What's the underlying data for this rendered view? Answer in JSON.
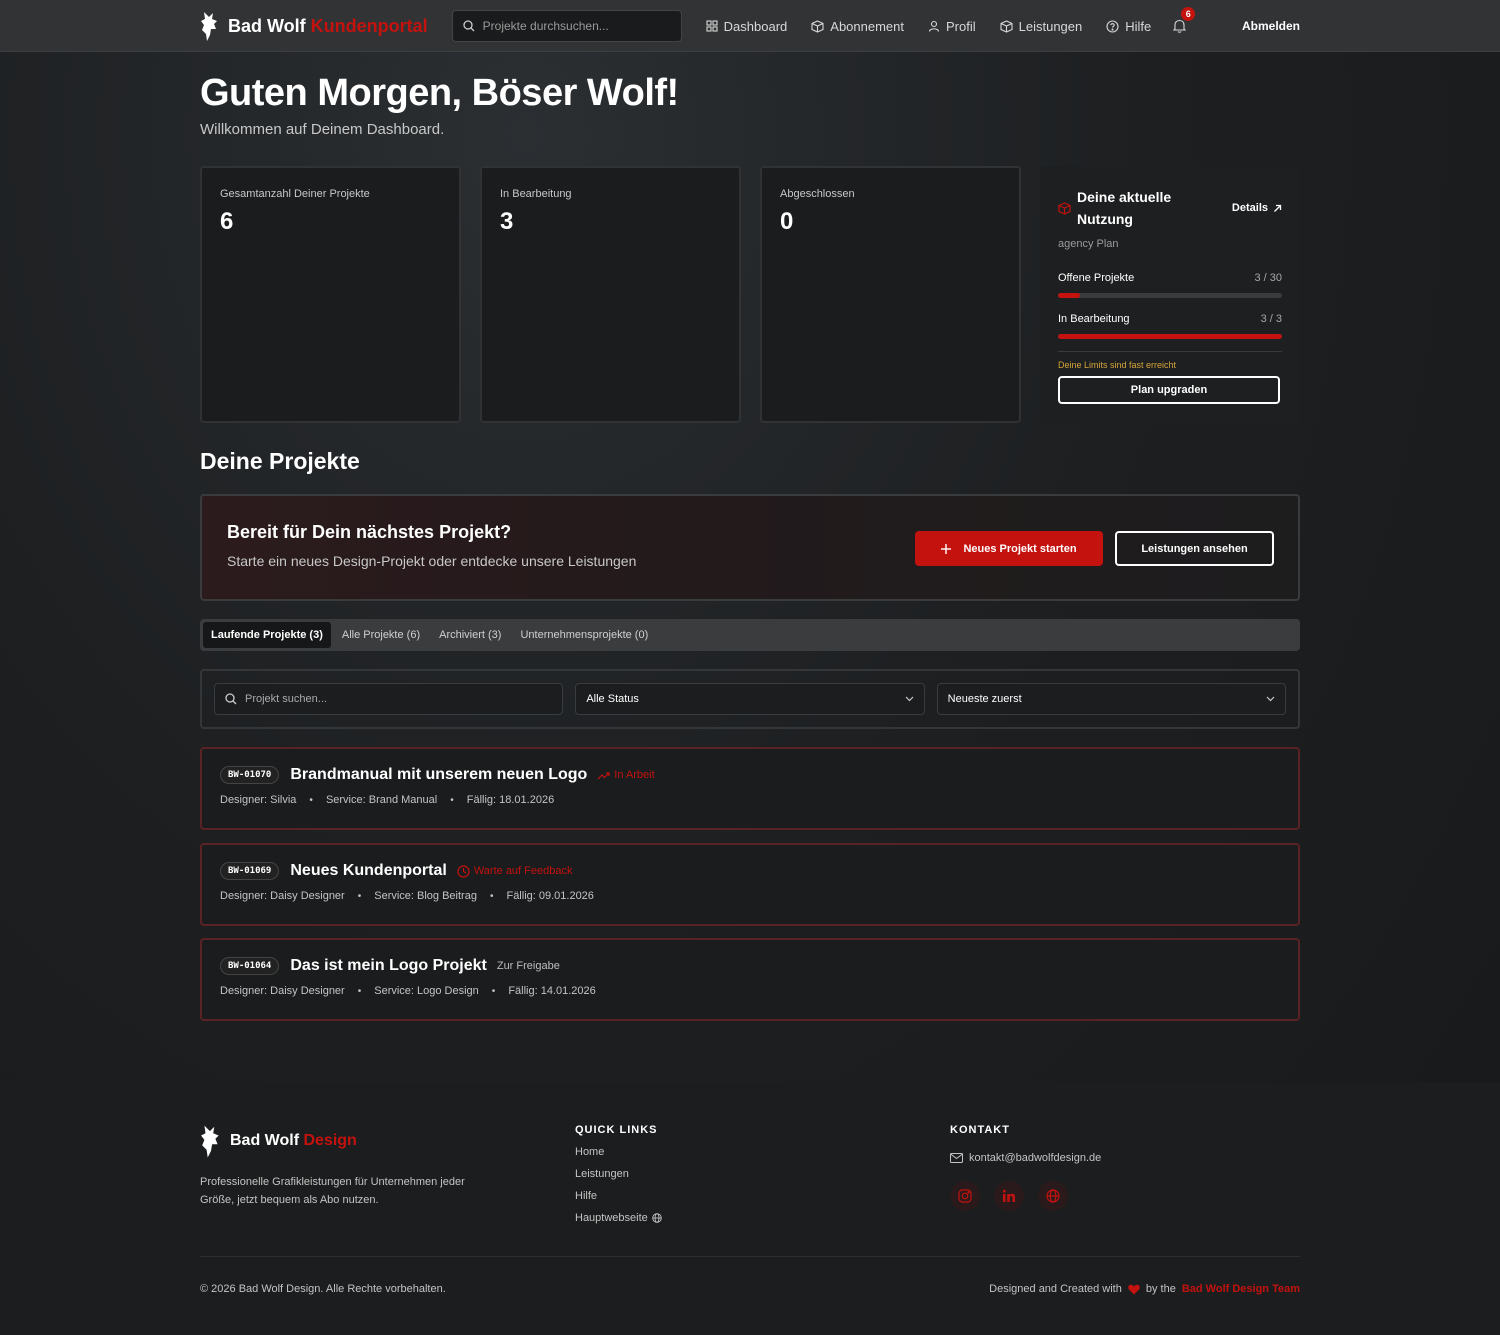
{
  "nav": {
    "brand": "Bad Wolf",
    "brand_accent": "Kundenportal",
    "search_placeholder": "Projekte durchsuchen...",
    "links": [
      {
        "label": "Dashboard",
        "icon": "grid-icon"
      },
      {
        "label": "Abonnement",
        "icon": "box-icon"
      },
      {
        "label": "Profil",
        "icon": "user-icon"
      },
      {
        "label": "Leistungen",
        "icon": "box-icon"
      },
      {
        "label": "Hilfe",
        "icon": "help-circle-icon"
      }
    ],
    "notification_count": "6",
    "logout": "Abmelden"
  },
  "greeting": {
    "title": "Guten Morgen, Böser Wolf!",
    "subtitle": "Willkommen auf Deinem Dashboard."
  },
  "stats": [
    {
      "label": "Gesamtanzahl Deiner Projekte",
      "value": "6"
    },
    {
      "label": "In Bearbeitung",
      "value": "3"
    },
    {
      "label": "Abgeschlossen",
      "value": "0"
    }
  ],
  "usage": {
    "title": "Deine aktuelle Nutzung",
    "details": "Details",
    "plan": "agency Plan",
    "rows": [
      {
        "label": "Offene Projekte",
        "count": "3 / 30",
        "fraction": 0.1
      },
      {
        "label": "In Bearbeitung",
        "count": "3 / 3",
        "fraction": 1.0
      }
    ],
    "warning": "Deine Limits sind fast erreicht",
    "upgrade": "Plan upgraden",
    "accent_color": "#c4120f",
    "warning_color": "#d6a53a"
  },
  "projects_section": {
    "title": "Deine Projekte"
  },
  "cta": {
    "title": "Bereit für Dein nächstes Projekt?",
    "subtitle": "Starte ein neues Design-Projekt oder entdecke unsere Leistungen",
    "primary": "Neues Projekt starten",
    "secondary": "Leistungen ansehen"
  },
  "tabs": [
    {
      "label": "Laufende Projekte (3)",
      "active": true
    },
    {
      "label": "Alle Projekte (6)",
      "active": false
    },
    {
      "label": "Archiviert (3)",
      "active": false
    },
    {
      "label": "Unternehmensprojekte (0)",
      "active": false
    }
  ],
  "filters": {
    "search_placeholder": "Projekt suchen...",
    "status_value": "Alle Status",
    "sort_value": "Neueste zuerst"
  },
  "projects": [
    {
      "id": "BW-01070",
      "title": "Brandmanual mit unserem neuen Logo",
      "status": "In Arbeit",
      "status_icon": "trending-up-icon",
      "status_color": "red",
      "designer": "Designer: Silvia",
      "service": "Service: Brand Manual",
      "due": "Fällig: 18.01.2026"
    },
    {
      "id": "BW-01069",
      "title": "Neues Kundenportal",
      "status": "Warte auf Feedback",
      "status_icon": "clock-icon",
      "status_color": "red",
      "designer": "Designer: Daisy Designer",
      "service": "Service: Blog Beitrag",
      "due": "Fällig: 09.01.2026"
    },
    {
      "id": "BW-01064",
      "title": "Das ist mein Logo Projekt",
      "status": "Zur Freigabe",
      "status_icon": "",
      "status_color": "gray",
      "designer": "Designer: Daisy Designer",
      "service": "Service: Logo Design",
      "due": "Fällig: 14.01.2026"
    }
  ],
  "footer": {
    "brand": "Bad Wolf",
    "brand_accent": "Design",
    "description": "Professionelle Grafikleistungen für Unternehmen jeder Größe, jetzt bequem als Abo nutzen.",
    "quick_links_heading": "QUICK LINKS",
    "quick_links": [
      "Home",
      "Leistungen",
      "Hilfe",
      "Hauptwebseite"
    ],
    "contact_heading": "KONTAKT",
    "email": "kontakt@badwolfdesign.de",
    "social": [
      "instagram-icon",
      "linkedin-icon",
      "globe-icon"
    ],
    "copyright": "© 2026 Bad Wolf Design. Alle Rechte vorbehalten.",
    "credits_prefix": "Designed and Created with",
    "credits_by": "by the",
    "credits_team": "Bad Wolf Design Team"
  }
}
